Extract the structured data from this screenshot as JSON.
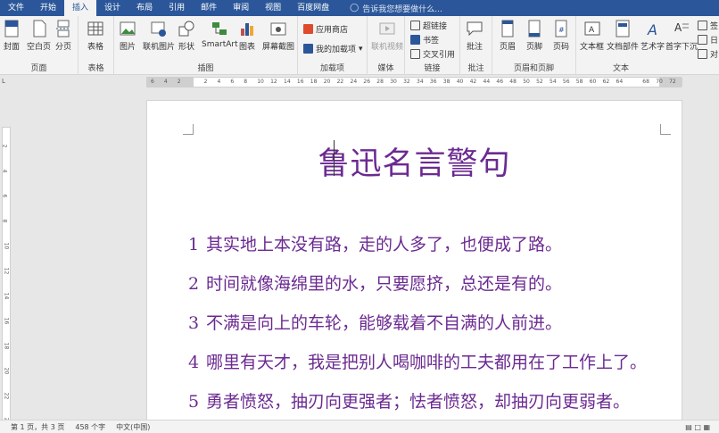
{
  "tabs": [
    "文件",
    "开始",
    "插入",
    "设计",
    "布局",
    "引用",
    "邮件",
    "审阅",
    "视图",
    "百度网盘"
  ],
  "active_tab": "插入",
  "tellme": "告诉我您想要做什么...",
  "ribbon": {
    "pages": {
      "name": "页面",
      "cover": "封面",
      "blank": "空白页",
      "break": "分页"
    },
    "table": {
      "name": "表格",
      "table": "表格"
    },
    "illus": {
      "name": "插图",
      "picture": "图片",
      "online": "联机图片",
      "shapes": "形状",
      "smartart": "SmartArt",
      "chart": "图表",
      "screenshot": "屏幕截图"
    },
    "addins": {
      "name": "加载项",
      "store": "应用商店",
      "my": "我的加载项"
    },
    "media": {
      "name": "媒体",
      "video": "联机视频"
    },
    "links": {
      "name": "链接",
      "hyperlink": "超链接",
      "bookmark": "书签",
      "crossref": "交叉引用"
    },
    "comments": {
      "name": "批注",
      "comment": "批注"
    },
    "hf": {
      "name": "页眉和页脚",
      "header": "页眉",
      "footer": "页脚",
      "pagenum": "页码"
    },
    "text": {
      "name": "文本",
      "textbox": "文本框",
      "parts": "文档部件",
      "wordart": "艺术字",
      "dropcap": "首字下沉",
      "sign": "签",
      "date": "日",
      "object": "对"
    }
  },
  "ruler": {
    "h": [
      "6",
      "4",
      "2",
      "",
      "2",
      "4",
      "6",
      "8",
      "10",
      "12",
      "14",
      "16",
      "18",
      "20",
      "22",
      "24",
      "26",
      "28",
      "30",
      "32",
      "34",
      "36",
      "38",
      "40",
      "42",
      "44",
      "46",
      "48",
      "50",
      "52",
      "54",
      "56",
      "58",
      "60",
      "62",
      "64",
      "",
      "68",
      "70",
      "72"
    ],
    "v": [
      "2",
      "4",
      "6",
      "8",
      "10",
      "12",
      "14",
      "16",
      "18",
      "20",
      "22",
      "24"
    ]
  },
  "document": {
    "title": "鲁迅名言警句",
    "quotes": [
      {
        "n": "1",
        "t": "其实地上本没有路，走的人多了，也便成了路。"
      },
      {
        "n": "2",
        "t": "时间就像海绵里的水，只要愿挤，总还是有的。"
      },
      {
        "n": "3",
        "t": "不满是向上的车轮，能够载着不自满的人前进。"
      },
      {
        "n": "4",
        "t": "哪里有天才，我是把别人喝咖啡的工夫都用在了工作上了。"
      },
      {
        "n": "5",
        "t": "勇者愤怒，抽刃向更强者；怯者愤怒，却抽刃向更弱者。"
      }
    ]
  },
  "status": {
    "page": "第 1 页，共 3 页",
    "words": "458 个字",
    "lang": "中文(中国)"
  },
  "colors": {
    "accent": "#2b579a",
    "text": "#6b2a91"
  }
}
